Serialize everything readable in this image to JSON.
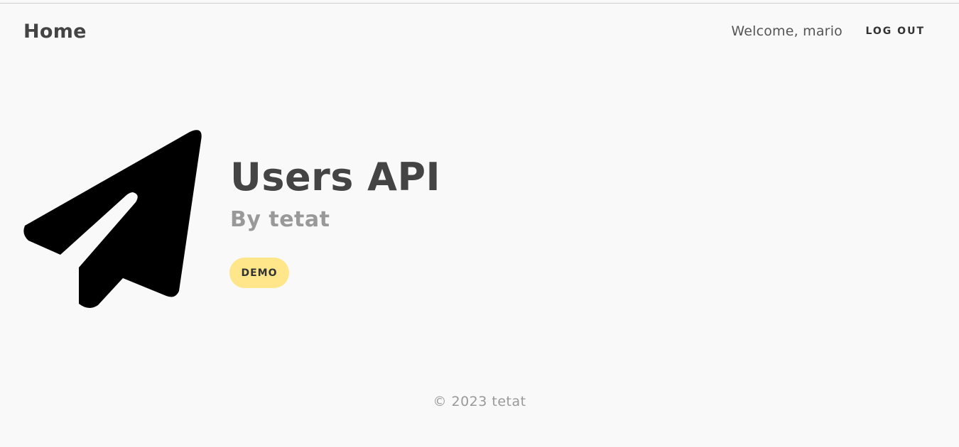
{
  "navbar": {
    "brand": "Home",
    "welcome_text": "Welcome, mario",
    "logout_label": "LOG OUT"
  },
  "hero": {
    "icon": "paper-plane-icon",
    "title": "Users API",
    "subtitle": "By tetat",
    "badge_label": "DEMO"
  },
  "footer": {
    "text": "© 2023 tetat"
  },
  "colors": {
    "background": "#f9f9f9",
    "text_primary": "#444444",
    "text_muted": "#999999",
    "badge": "#ffe68a",
    "icon": "#000000"
  }
}
